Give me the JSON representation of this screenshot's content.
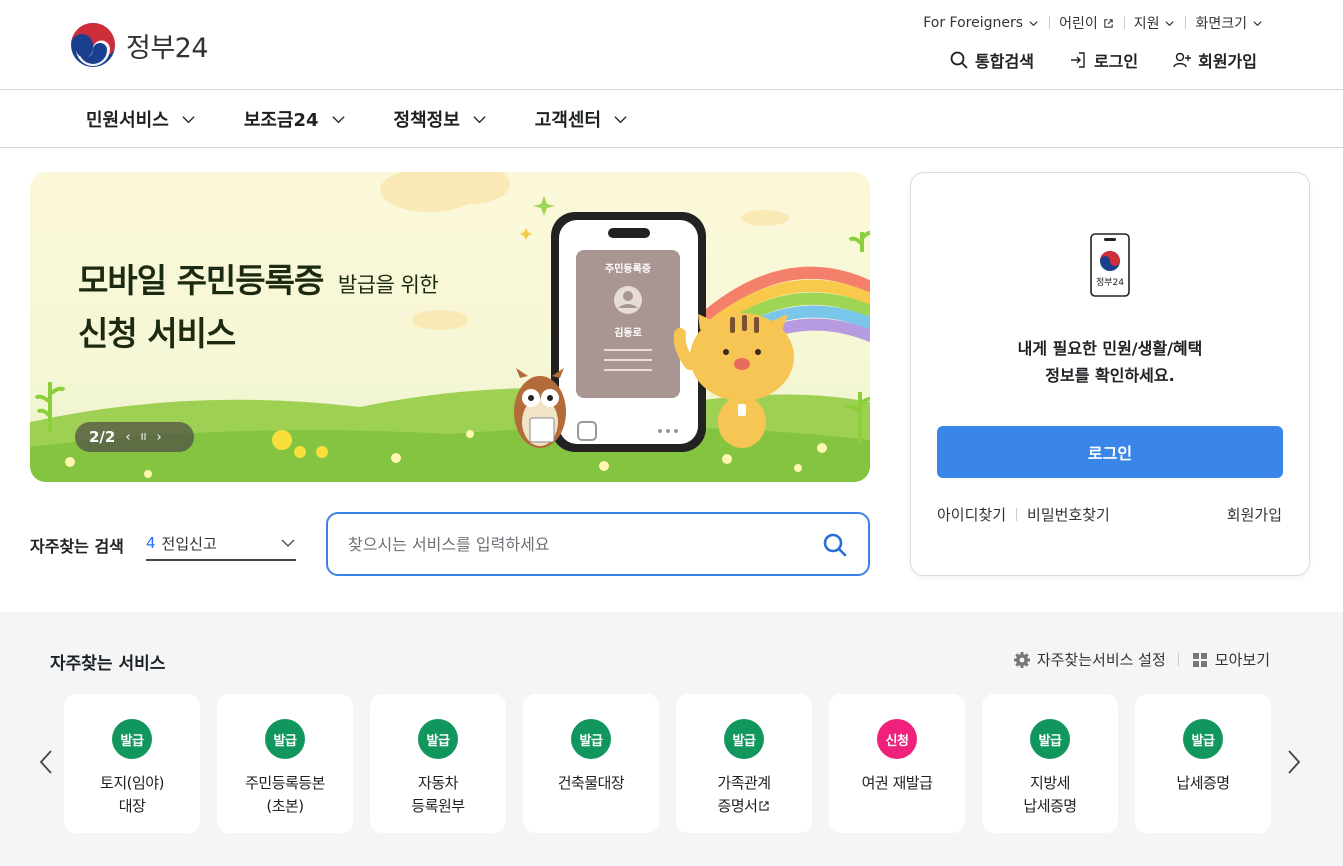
{
  "header": {
    "logo_text": "정부24",
    "util_links": [
      {
        "label": "For Foreigners",
        "icon": "chevron-down-icon"
      },
      {
        "label": "어린이",
        "icon": "external-link-icon"
      },
      {
        "label": "지원",
        "icon": "chevron-down-icon"
      },
      {
        "label": "화면크기",
        "icon": "chevron-down-icon"
      }
    ],
    "actions": {
      "search": "통합검색",
      "login": "로그인",
      "signup": "회원가입"
    }
  },
  "nav": {
    "items": [
      "민원서비스",
      "보조금24",
      "정책정보",
      "고객센터"
    ]
  },
  "banner": {
    "title_main": "모바일 주민등록증",
    "title_small": "발급을 위한",
    "title_line2": "신청 서비스",
    "card_label": "주민등록증",
    "card_name": "김동로",
    "carousel_position": "2/2",
    "prev": "‹",
    "pause": "II",
    "next": "›"
  },
  "search": {
    "freq_label": "자주찾는 검색",
    "freq_rank": "4",
    "freq_term": "전입신고",
    "placeholder": "찾으시는 서비스를 입력하세요"
  },
  "login_card": {
    "icon_label": "정부24",
    "message_line1": "내게 필요한 민원/생활/혜택",
    "message_line2": "정보를 확인하세요.",
    "login_button": "로그인",
    "find_id": "아이디찾기",
    "find_password": "비밀번호찾기",
    "signup": "회원가입"
  },
  "services": {
    "title": "자주찾는 서비스",
    "settings_label": "자주찾는서비스 설정",
    "view_all_label": "모아보기",
    "badge_colors": {
      "issue": "#11965e",
      "apply": "#f0217a"
    },
    "items": [
      {
        "badge": "발급",
        "line1": "토지(임야)",
        "line2": "대장"
      },
      {
        "badge": "발급",
        "line1": "주민등록등본",
        "line2": "(초본)"
      },
      {
        "badge": "발급",
        "line1": "자동차",
        "line2": "등록원부"
      },
      {
        "badge": "발급",
        "line1": "건축물대장",
        "line2": ""
      },
      {
        "badge": "발급",
        "line1": "가족관계",
        "line2": "증명서"
      },
      {
        "badge": "신청",
        "line1": "여권 재발급",
        "line2": ""
      },
      {
        "badge": "발급",
        "line1": "지방세",
        "line2": "납세증명"
      },
      {
        "badge": "발급",
        "line1": "납세증명",
        "line2": ""
      }
    ]
  }
}
